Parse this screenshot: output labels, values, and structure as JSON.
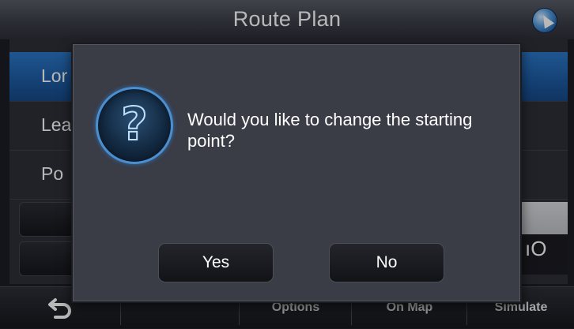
{
  "header": {
    "title": "Route Plan",
    "icon": "globe-icon"
  },
  "list": {
    "items": [
      {
        "label": "Lor"
      },
      {
        "label": "Lea"
      },
      {
        "label": "Po"
      }
    ]
  },
  "right_field": {
    "text": "ıO"
  },
  "bottombar": {
    "back_icon": "back-arrow-icon",
    "options_label": "Options",
    "onmap_label": "On Map",
    "simulate_label": "Simulate"
  },
  "dialog": {
    "icon": "question-icon",
    "message": "Would you like to change the starting point?",
    "yes_label": "Yes",
    "no_label": "No"
  },
  "colors": {
    "selected_row": "#1d5ba3",
    "dialog_bg": "#3a3c46",
    "icon_ring": "#4c8fd0"
  }
}
